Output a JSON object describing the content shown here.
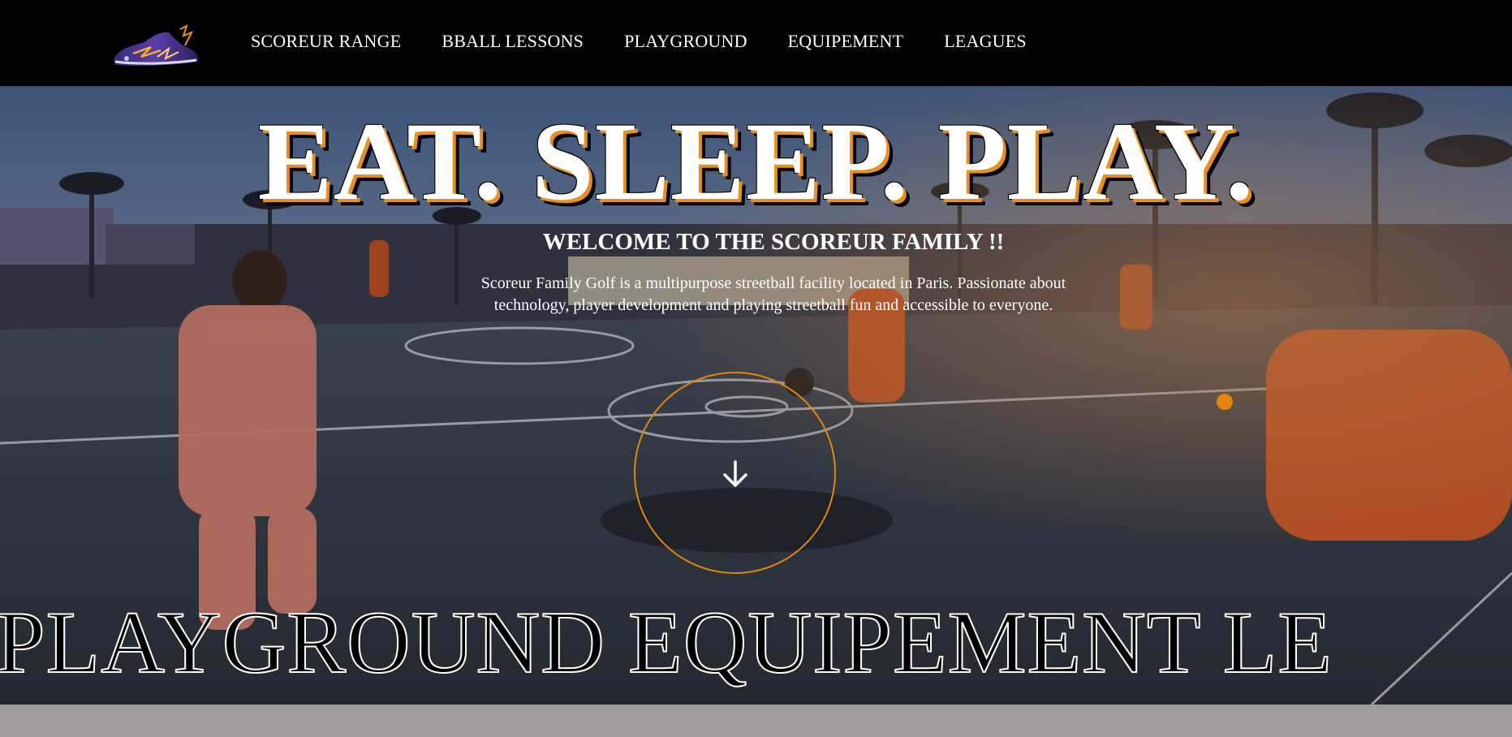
{
  "nav": {
    "logo_icon": "basketball-shoe-logo",
    "links": [
      {
        "label": "SCOREUR RANGE"
      },
      {
        "label": "BBALL LESSONS"
      },
      {
        "label": "PLAYGROUND"
      },
      {
        "label": "EQUIPEMENT"
      },
      {
        "label": "LEAGUES"
      }
    ]
  },
  "hero": {
    "headline": "EAT. SLEEP. PLAY.",
    "welcome": "WELCOME TO THE SCOREUR FAMILY !!",
    "intro": "Scoreur Family Golf is a multipurpose streetball facility located in Paris. Passionate about technology, player development and playing streetball fun and accessible to everyone.",
    "scroll_icon": "arrow-down-icon",
    "marquee": "PLAYGROUND EQUIPEMENT LE"
  },
  "colors": {
    "accent": "#e0870f",
    "nav_background": "#000000",
    "footer_strip": "#9e9d9a"
  }
}
